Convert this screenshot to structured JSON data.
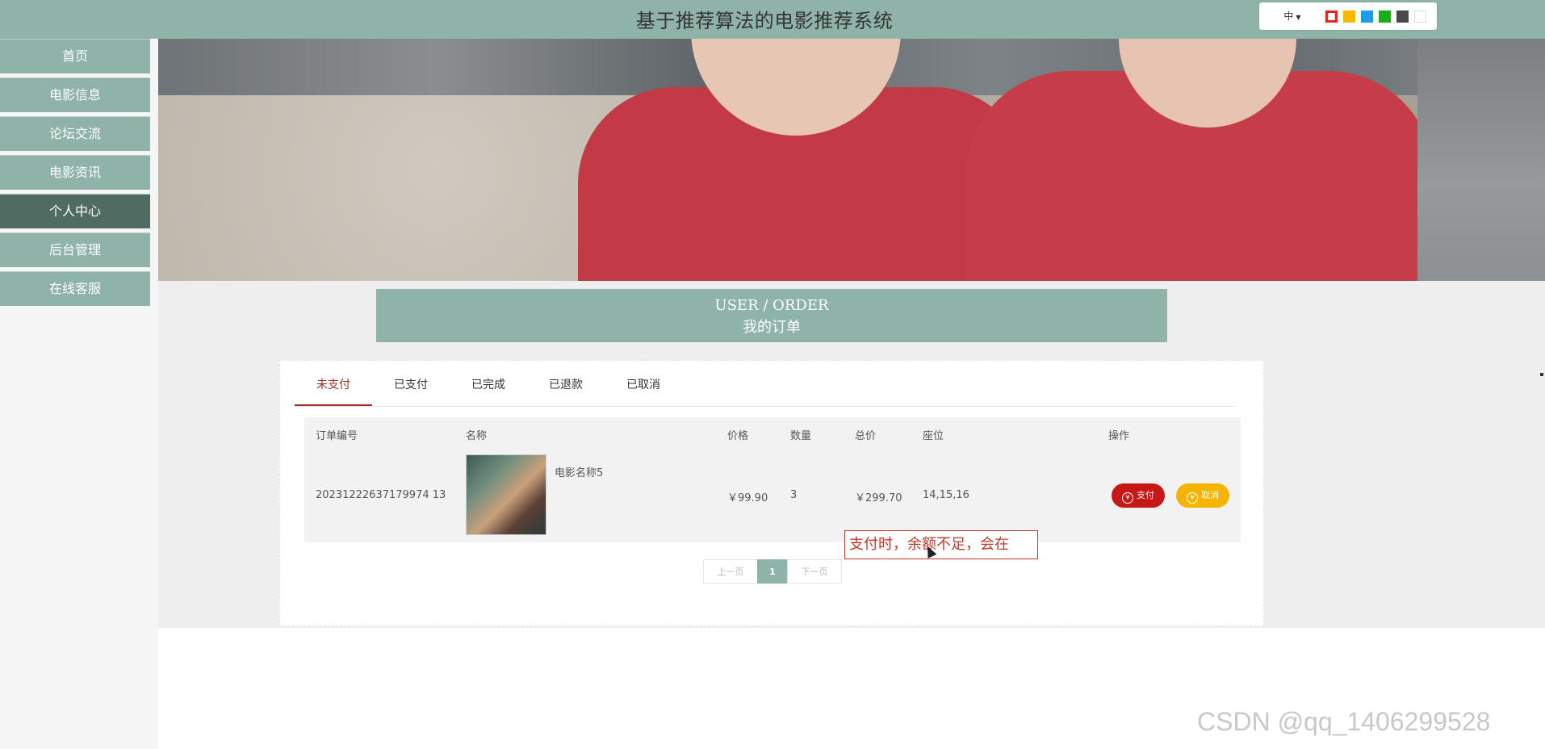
{
  "header": {
    "site_title": "基于推荐算法的电影推荐系统",
    "language": "中",
    "theme_swatches": [
      "#e8231a",
      "#f5b800",
      "#1e9be8",
      "#1aad19",
      "#4a4a4a",
      "#ffffff"
    ]
  },
  "nav": {
    "items": [
      {
        "label": "首页"
      },
      {
        "label": "电影信息"
      },
      {
        "label": "论坛交流"
      },
      {
        "label": "电影资讯"
      },
      {
        "label": "个人中心"
      },
      {
        "label": "后台管理"
      },
      {
        "label": "在线客服"
      }
    ],
    "active_index": 4
  },
  "page": {
    "title_en": "USER / ORDER",
    "title_cn": "我的订单"
  },
  "tabs": [
    {
      "label": "未支付"
    },
    {
      "label": "已支付"
    },
    {
      "label": "已完成"
    },
    {
      "label": "已退款"
    },
    {
      "label": "已取消"
    }
  ],
  "active_tab": 0,
  "table": {
    "headers": {
      "order_no": "订单编号",
      "name": "名称",
      "price": "价格",
      "quantity": "数量",
      "total": "总价",
      "seat": "座位",
      "action": "操作"
    },
    "rows": [
      {
        "order_no": "20231222637179974 13",
        "name": "电影名称5",
        "price": "￥99.90",
        "quantity": "3",
        "total": "￥299.70",
        "seat": "14,15,16",
        "pay_label": "支付",
        "cancel_label": "取消",
        "currency_icon": "¥"
      }
    ]
  },
  "pagination": {
    "prev": "上一页",
    "current": "1",
    "next": "下一页"
  },
  "annotation": {
    "text": "支付时，余额不足，会在"
  },
  "watermark": "CSDN @qq_1406299528",
  "colors": {
    "accent": "#8fb3a8",
    "active_nav": "#4f6b62",
    "pay": "#c71818",
    "cancel": "#f5b400",
    "tab_active": "#a22a2a"
  }
}
